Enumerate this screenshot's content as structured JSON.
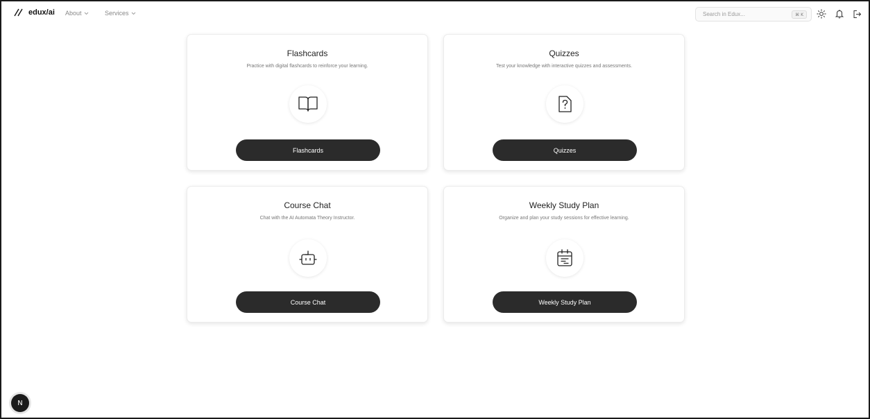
{
  "header": {
    "logo_text": "edux/ai",
    "nav": [
      {
        "label": "About"
      },
      {
        "label": "Services"
      }
    ],
    "search": {
      "placeholder": "Search in Edux...",
      "shortcut": "⌘ K"
    },
    "icons": [
      "slash-logo-icon",
      "chevron-down-icon",
      "sun-icon",
      "bell-icon",
      "logout-icon"
    ]
  },
  "cards": [
    {
      "title": "Flashcards",
      "description": "Practice with digital flashcards to reinforce your learning.",
      "icon": "book-open-icon",
      "button_label": "Flashcards"
    },
    {
      "title": "Quizzes",
      "description": "Test your knowledge with interactive quizzes and assessments.",
      "icon": "file-question-icon",
      "button_label": "Quizzes"
    },
    {
      "title": "Course Chat",
      "description": "Chat with the AI Automata Theory Instructor.",
      "icon": "bot-icon",
      "button_label": "Course Chat"
    },
    {
      "title": "Weekly Study Plan",
      "description": "Organize and plan your study sessions for effective learning.",
      "icon": "calendar-icon",
      "button_label": "Weekly Study Plan"
    }
  ],
  "badge": {
    "label": "N",
    "icon": "nextjs-logo-icon"
  },
  "colors": {
    "button_bg": "#2b2b2b",
    "button_text": "#ffffff",
    "border": "#1a1a1a"
  }
}
